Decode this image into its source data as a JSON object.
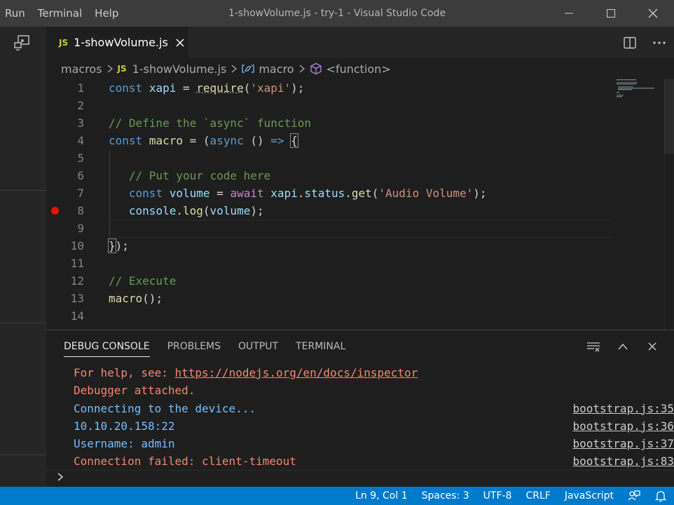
{
  "titlebar": {
    "menu": [
      "Run",
      "Terminal",
      "Help"
    ],
    "title": "1-showVolume.js - try-1 - Visual Studio Code"
  },
  "tabs": [
    {
      "badge": "JS",
      "label": "1-showVolume.js",
      "active": true
    }
  ],
  "breadcrumbs": {
    "folder": "macros",
    "file_badge": "JS",
    "file": "1-showVolume.js",
    "symbol": "macro",
    "function": "<function>"
  },
  "editor": {
    "line_numbers": [
      "1",
      "2",
      "3",
      "4",
      "5",
      "6",
      "7",
      "8",
      "9",
      "10",
      "11",
      "12",
      "13",
      "14"
    ],
    "breakpoint_line": "8",
    "cursor_line": "9",
    "code_lines": [
      "const xapi = require('xapi');",
      "",
      "// Define the `async` function",
      "const macro = (async () => {",
      "",
      "   // Put your code here",
      "   const volume = await xapi.status.get('Audio Volume');",
      "   console.log(volume);",
      "",
      "});",
      "",
      "// Execute",
      "macro();",
      ""
    ]
  },
  "panel": {
    "tabs": [
      "DEBUG CONSOLE",
      "PROBLEMS",
      "OUTPUT",
      "TERMINAL"
    ],
    "active_tab": "DEBUG CONSOLE",
    "console": [
      {
        "prefix": "For help, see: ",
        "link": "https://nodejs.org/en/docs/inspector",
        "text": "",
        "source": "",
        "kind": "error"
      },
      {
        "prefix": "",
        "link": "",
        "text": "Debugger attached.",
        "source": "",
        "kind": "error"
      },
      {
        "prefix": "",
        "link": "",
        "text": "Connecting to the device...",
        "source": "bootstrap.js:35",
        "kind": "info"
      },
      {
        "prefix": "",
        "link": "",
        "text": "10.10.20.158:22",
        "source": "bootstrap.js:36",
        "kind": "info"
      },
      {
        "prefix": "",
        "link": "",
        "text": "Username: admin",
        "source": "bootstrap.js:37",
        "kind": "info"
      },
      {
        "prefix": "",
        "link": "",
        "text": "Connection failed: client-timeout",
        "source": "bootstrap.js:83",
        "kind": "error"
      }
    ]
  },
  "statusbar": {
    "position": "Ln 9, Col 1",
    "spaces": "Spaces: 3",
    "encoding": "UTF-8",
    "eol": "CRLF",
    "language": "JavaScript"
  },
  "colors": {
    "accent": "#007acc",
    "breakpoint": "#e51400",
    "error_text": "#f48771",
    "info_text": "#75beff"
  },
  "icons": [
    "remote-explorer-icon",
    "close-icon",
    "split-editor-icon",
    "more-actions-icon",
    "variable-icon",
    "function-cube-icon",
    "clear-console-icon",
    "chevron-up-icon",
    "chevron-right-prompt-icon",
    "feedback-icon",
    "bell-icon"
  ]
}
